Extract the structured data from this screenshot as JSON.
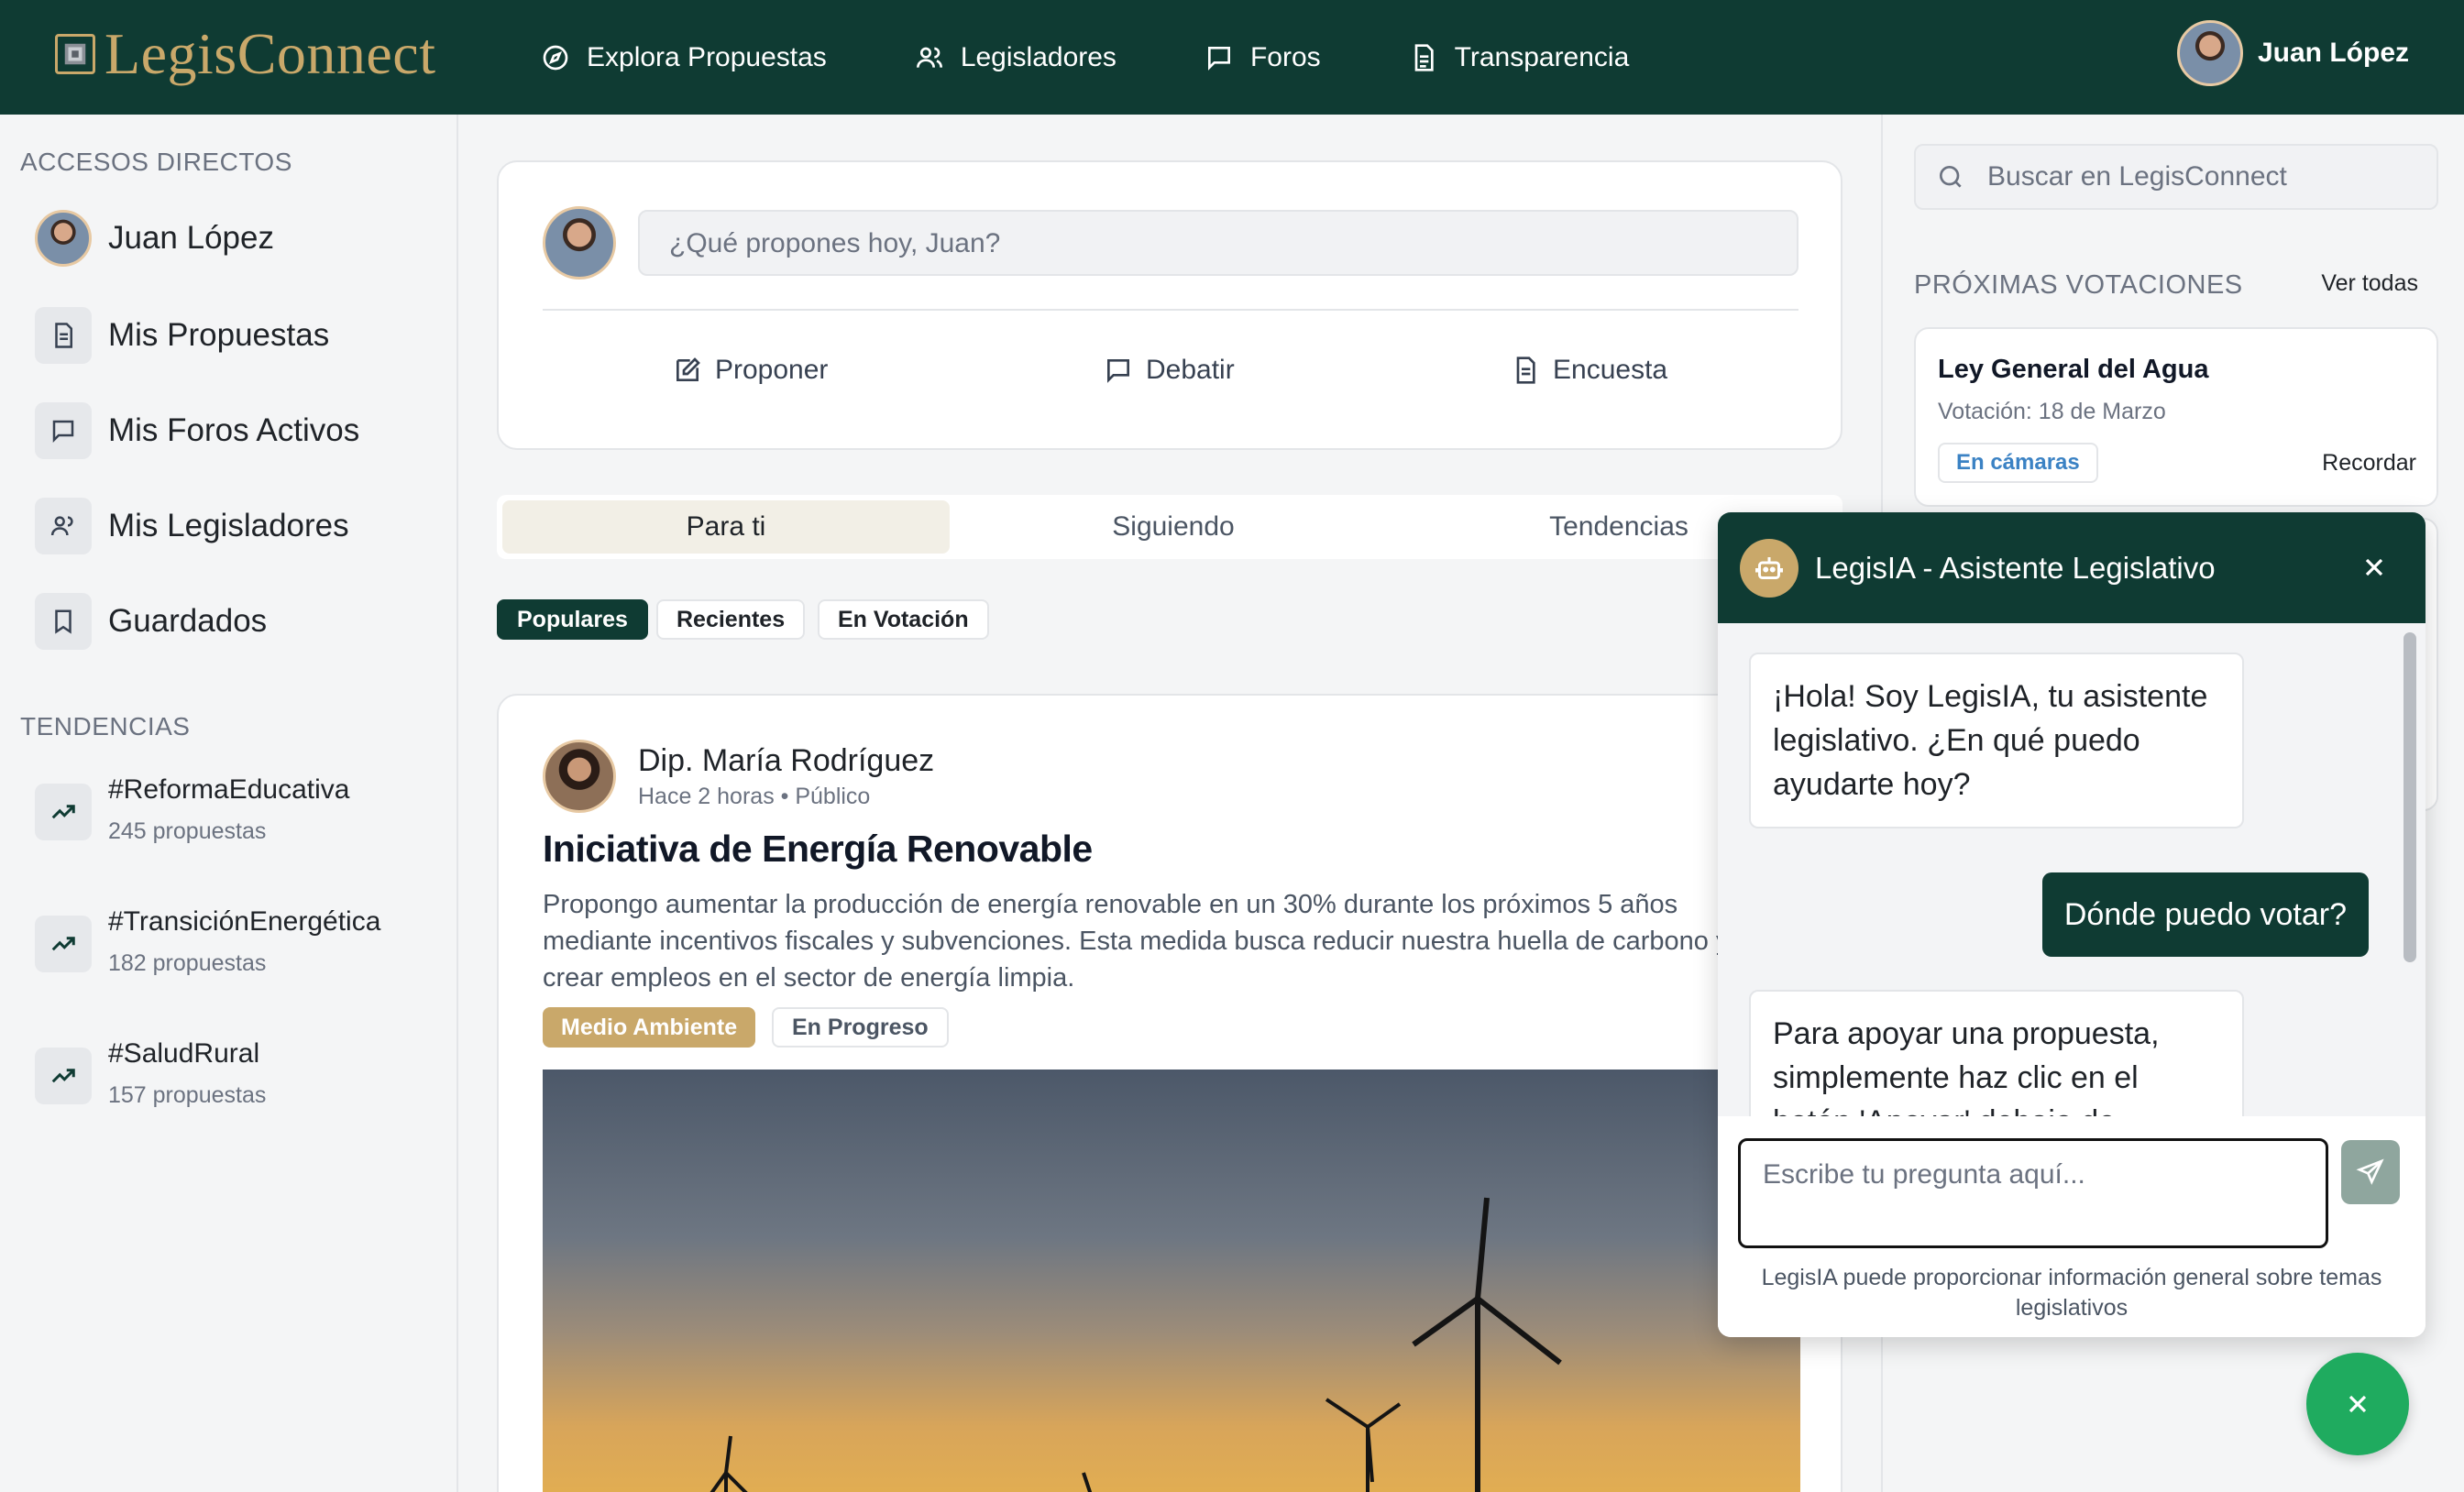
{
  "brand": {
    "name": "LegisConnect",
    "accent": "#c9a86a",
    "primary": "#0f3b33"
  },
  "nav": {
    "items": [
      {
        "label": "Explora Propuestas",
        "icon": "compass-icon"
      },
      {
        "label": "Legisladores",
        "icon": "users-icon"
      },
      {
        "label": "Foros",
        "icon": "chat-icon"
      },
      {
        "label": "Transparencia",
        "icon": "document-icon"
      }
    ],
    "user_name": "Juan López"
  },
  "sidebar": {
    "shortcuts_title": "ACCESOS DIRECTOS",
    "items": [
      {
        "label": "Juan López",
        "icon": "avatar"
      },
      {
        "label": "Mis Propuestas",
        "icon": "document-icon"
      },
      {
        "label": "Mis Foros Activos",
        "icon": "chat-icon"
      },
      {
        "label": "Mis Legisladores",
        "icon": "users-icon"
      },
      {
        "label": "Guardados",
        "icon": "bookmark-icon"
      }
    ],
    "trends_title": "TENDENCIAS",
    "trends": [
      {
        "tag": "#ReformaEducativa",
        "count": "245 propuestas"
      },
      {
        "tag": "#TransiciónEnergética",
        "count": "182 propuestas"
      },
      {
        "tag": "#SaludRural",
        "count": "157 propuestas"
      }
    ]
  },
  "composer": {
    "placeholder": "¿Qué propones hoy, Juan?",
    "actions": [
      {
        "label": "Proponer",
        "icon": "edit-icon"
      },
      {
        "label": "Debatir",
        "icon": "chat-icon"
      },
      {
        "label": "Encuesta",
        "icon": "document-icon"
      }
    ]
  },
  "feed": {
    "tabs": [
      "Para ti",
      "Siguiendo",
      "Tendencias"
    ],
    "active_tab": "Para ti",
    "filters": [
      "Populares",
      "Recientes",
      "En Votación"
    ],
    "active_filter": "Populares"
  },
  "post": {
    "author": "Dip. María Rodríguez",
    "meta": "Hace 2 horas • Público",
    "title": "Iniciativa de Energía Renovable",
    "body": "Propongo aumentar la producción de energía renovable en un 30% durante los próximos 5 años mediante incentivos fiscales y subvenciones. Esta medida busca reducir nuestra huella de carbono y crear empleos en el sector de energía limpia.",
    "tags": [
      "Medio Ambiente",
      "En Progreso"
    ]
  },
  "right": {
    "search_placeholder": "Buscar en LegisConnect",
    "votes_title": "PRÓXIMAS VOTACIONES",
    "votes_all": "Ver todas",
    "votes": [
      {
        "name": "Ley General del Agua",
        "date": "Votación: 18 de Marzo",
        "status": "En cámaras",
        "action": "Recordar"
      }
    ]
  },
  "chat": {
    "title": "LegisIA - Asistente Legislativo",
    "messages": [
      {
        "from": "bot",
        "text": "¡Hola! Soy LegisIA, tu asistente legislativo. ¿En qué puedo ayudarte hoy?"
      },
      {
        "from": "user",
        "text": "Dónde puedo votar?"
      },
      {
        "from": "bot",
        "text": "Para apoyar una propuesta, simplemente haz clic en el botón 'Apoyar' debajo de"
      }
    ],
    "input_placeholder": "Escribe tu pregunta aquí...",
    "note": "LegisIA puede proporcionar información general sobre temas legislativos"
  }
}
